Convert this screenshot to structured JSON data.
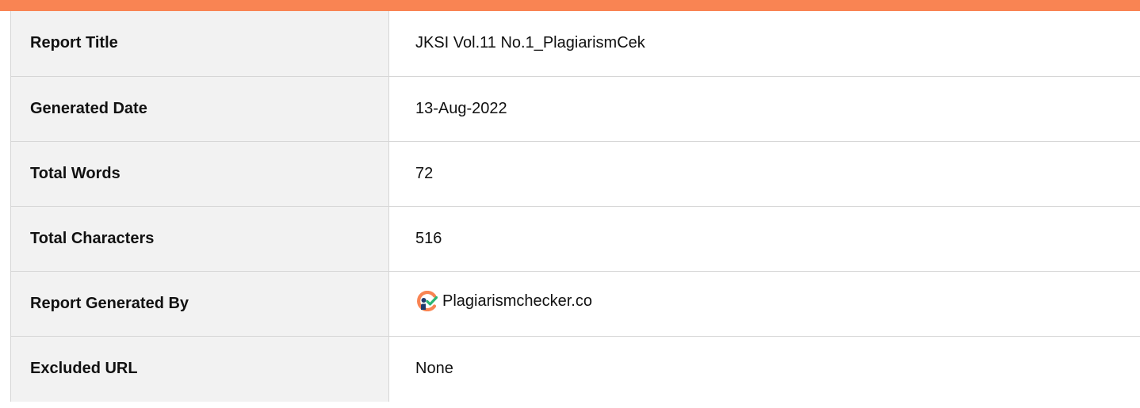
{
  "report": {
    "rows": [
      {
        "label": "Report Title",
        "value": "JKSI Vol.11 No.1_PlagiarismCek"
      },
      {
        "label": "Generated Date",
        "value": "13-Aug-2022"
      },
      {
        "label": "Total Words",
        "value": "72"
      },
      {
        "label": "Total Characters",
        "value": "516"
      },
      {
        "label": "Report Generated By",
        "value": "Plagiarismchecker.co",
        "icon": "plagiarismchecker-logo-icon"
      },
      {
        "label": "Excluded URL",
        "value": "None"
      }
    ]
  },
  "colors": {
    "accent": "#f98453",
    "label_background": "#f2f2f2",
    "logo_orange": "#f98453",
    "logo_navy": "#1f3a6e",
    "logo_green": "#2bb673"
  }
}
